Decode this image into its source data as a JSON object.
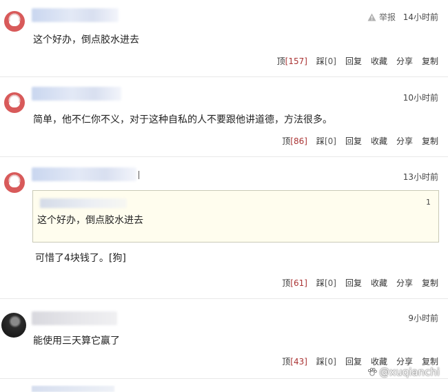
{
  "comments": [
    {
      "time": "14小时前",
      "report_label": "举报",
      "text": "这个好办，倒点胶水进去",
      "actions": {
        "up": "顶",
        "up_count": "[157]",
        "down": "踩",
        "down_count": "[0]",
        "reply": "回复",
        "favorite": "收藏",
        "share": "分享",
        "copy": "复制"
      }
    },
    {
      "time": "10小时前",
      "text": "简单，他不仁你不义，对于这种自私的人不要跟他讲道德，方法很多。",
      "actions": {
        "up": "顶",
        "up_count": "[86]",
        "down": "踩",
        "down_count": "[0]",
        "reply": "回复",
        "favorite": "收藏",
        "share": "分享",
        "copy": "复制"
      }
    },
    {
      "time": "13小时前",
      "quote": {
        "floor": "1",
        "text": "这个好办，倒点胶水进去"
      },
      "text": "可惜了4块钱了。[狗]",
      "actions": {
        "up": "顶",
        "up_count": "[61]",
        "down": "踩",
        "down_count": "[0]",
        "reply": "回复",
        "favorite": "收藏",
        "share": "分享",
        "copy": "复制"
      }
    },
    {
      "time": "9小时前",
      "text": "能使用三天算它赢了",
      "actions": {
        "up": "顶",
        "up_count": "[43]",
        "down": "踩",
        "down_count": "[0]",
        "reply": "回复",
        "favorite": "收藏",
        "share": "分享",
        "copy": "复制"
      }
    }
  ],
  "watermark": "@xuqianchi",
  "colors": {
    "up_count": "#aa3333",
    "quote_bg": "#fffdee",
    "avatar_red": "#d85a5a"
  }
}
